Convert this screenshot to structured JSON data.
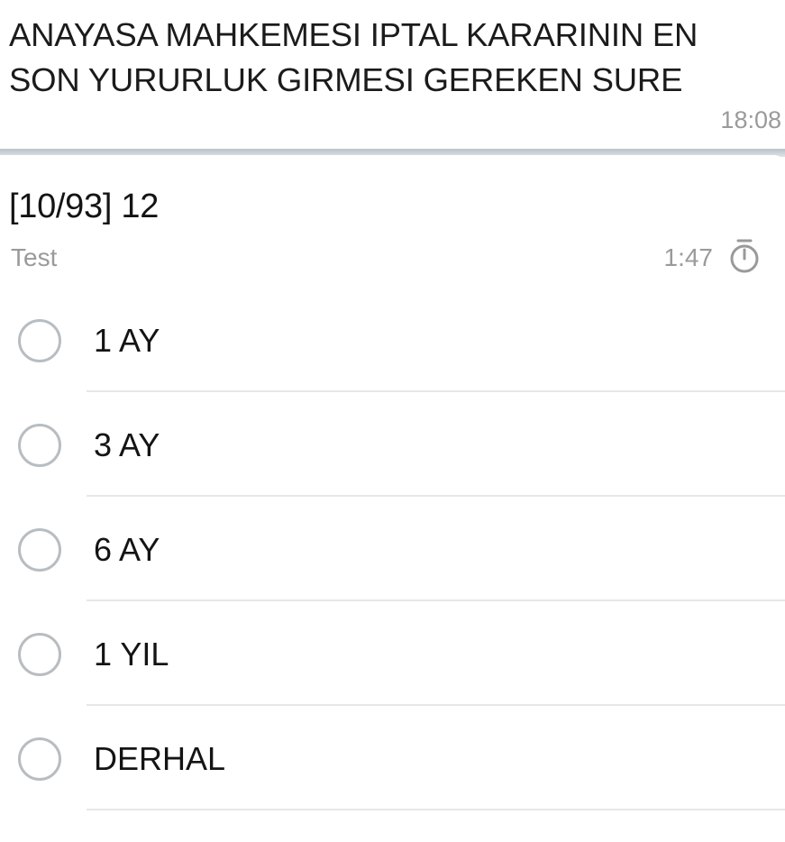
{
  "message": {
    "text": "ANAYASA MAHKEMESI IPTAL KARARININ EN SON YURURLUK GIRMESI GEREKEN SURE",
    "time": "18:08"
  },
  "poll": {
    "question": "[10/93] 12",
    "type_label": "Test",
    "timer": "1:47",
    "timer_icon": "stopwatch-icon",
    "options": [
      {
        "label": "1 AY"
      },
      {
        "label": "3 AY"
      },
      {
        "label": "6 AY"
      },
      {
        "label": "1 YIL"
      },
      {
        "label": "DERHAL"
      }
    ]
  },
  "colors": {
    "text": "#141414",
    "muted": "#9a9a9a",
    "radio_border": "#b8bdc1",
    "divider": "#e7e7e7"
  }
}
